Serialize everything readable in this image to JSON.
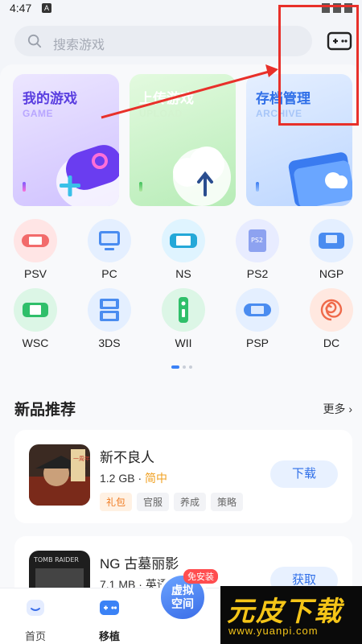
{
  "status_bar": {
    "time": "4:47",
    "app_icon": "A"
  },
  "search": {
    "placeholder": "搜索游戏"
  },
  "feature_cards": [
    {
      "title": "我的游戏",
      "subtitle": "GAME"
    },
    {
      "title": "上传游戏",
      "subtitle": "UPLOAD"
    },
    {
      "title": "存档管理",
      "subtitle": "ARCHIVE"
    }
  ],
  "emulators": [
    {
      "label": "PSV",
      "color": "#ffe5e5"
    },
    {
      "label": "PC",
      "color": "#e4efff"
    },
    {
      "label": "NS",
      "color": "#dff4ff"
    },
    {
      "label": "PS2",
      "color": "#e8ecff"
    },
    {
      "label": "NGP",
      "color": "#e4efff"
    },
    {
      "label": "WSC",
      "color": "#dcf6e6"
    },
    {
      "label": "3DS",
      "color": "#e4efff"
    },
    {
      "label": "WII",
      "color": "#dcf6e6"
    },
    {
      "label": "PSP",
      "color": "#e4efff"
    },
    {
      "label": "DC",
      "color": "#ffe8e0"
    }
  ],
  "new_games": {
    "title": "新品推荐",
    "more": "更多 ›",
    "items": [
      {
        "name": "新不良人",
        "size": "1.2 GB",
        "lang": "简中",
        "tags": [
          "礼包",
          "官服",
          "养成",
          "策略"
        ],
        "button": "下载",
        "cover_text": "一周年"
      },
      {
        "name": "NG 古墓丽影",
        "size": "7.1 MB",
        "lang": "英语",
        "tags": [],
        "button": "获取",
        "cover_text": "TOMB RAIDER"
      }
    ]
  },
  "bottom_nav": {
    "home": "首页",
    "port": "移植",
    "center_line1": "虚拟",
    "center_line2": "空间",
    "badge": "免安装"
  },
  "watermark": {
    "title": "元皮下载",
    "url": "www.yuanpi.com"
  },
  "colors": {
    "accent": "#2f6fe8",
    "annotation": "#e8302a"
  }
}
